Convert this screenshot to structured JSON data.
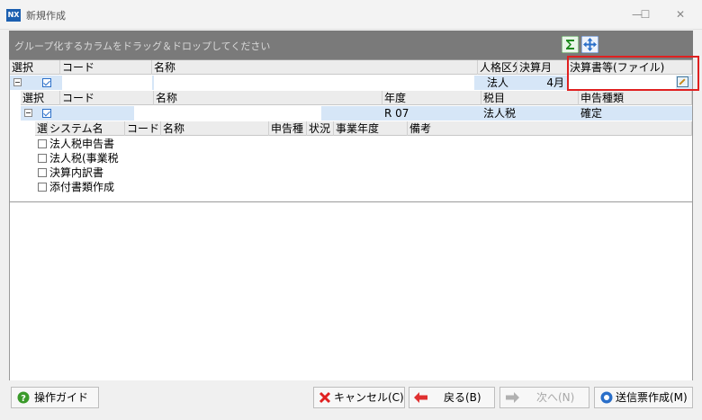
{
  "window": {
    "app_icon_text": "NX",
    "title": "新規作成",
    "minimize": "—",
    "maximize": "☐",
    "close": "✕"
  },
  "grouping_bar": {
    "hint": "グループ化するカラムをドラッグ＆ドロップしてください",
    "icons": [
      "sigma-icon",
      "move-icon"
    ]
  },
  "grid_level1": {
    "headers": [
      "選択",
      "コード",
      "名称",
      "人格区分",
      "決算月",
      "決算書等(ファイル)"
    ],
    "row": {
      "checked": true,
      "code": "",
      "name": "",
      "entity_type": "法人",
      "closing_month": "4月",
      "file": ""
    }
  },
  "grid_level2": {
    "headers": [
      "選択",
      "コード",
      "名称",
      "年度",
      "税目",
      "申告種類"
    ],
    "row": {
      "checked": true,
      "code": "",
      "name": "",
      "year": "R 07",
      "tax_item": "法人税",
      "report_type": "確定"
    }
  },
  "grid_level3": {
    "headers": [
      "選",
      "システム名",
      "コード",
      "名称",
      "申告種",
      "状況",
      "事業年度",
      "備考"
    ],
    "rows": [
      {
        "checked": false,
        "system_name": "法人税申告書"
      },
      {
        "checked": false,
        "system_name": "法人税(事業税"
      },
      {
        "checked": false,
        "system_name": "決算内訳書"
      },
      {
        "checked": false,
        "system_name": "添付書類作成"
      }
    ]
  },
  "footer": {
    "guide_label": "操作ガイド",
    "cancel_label": "キャンセル(C)",
    "back_label": "戻る(B)",
    "next_label": "次へ(N)",
    "create_label": "送信票作成(M)"
  },
  "colors": {
    "grouping_bar": "#7a7a7a",
    "selected_row": "#d6e6f7",
    "highlight_box": "#e02020",
    "accent": "#2a6fc9"
  }
}
